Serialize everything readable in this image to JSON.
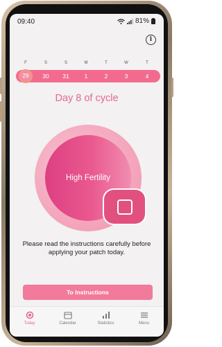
{
  "status_bar": {
    "time": "09:40",
    "battery": "81%"
  },
  "calendar_strip": {
    "weekdays": [
      "F",
      "S",
      "S",
      "M",
      "T",
      "W",
      "T"
    ],
    "dates": [
      "29",
      "30",
      "31",
      "1",
      "2",
      "3",
      "4"
    ],
    "selected_index": 0
  },
  "cycle": {
    "title": "Day 8 of cycle",
    "fertility_status": "High Fertility"
  },
  "instructions": {
    "text": "Please read the instructions carefully before applying your patch today.",
    "button_label": "To Instructions"
  },
  "tab_bar": {
    "items": [
      {
        "label": "Today",
        "icon": "today-icon",
        "active": true
      },
      {
        "label": "Calendar",
        "icon": "calendar-icon",
        "active": false
      },
      {
        "label": "Statistics",
        "icon": "statistics-icon",
        "active": false
      },
      {
        "label": "Menu",
        "icon": "menu-icon",
        "active": false
      }
    ]
  },
  "colors": {
    "accent": "#f26b8f",
    "title_pink": "#e26a8e",
    "inner_circle": "#e24f89",
    "outer_ring": "#f4a6bd",
    "selected_ring": "#f2a35e"
  }
}
